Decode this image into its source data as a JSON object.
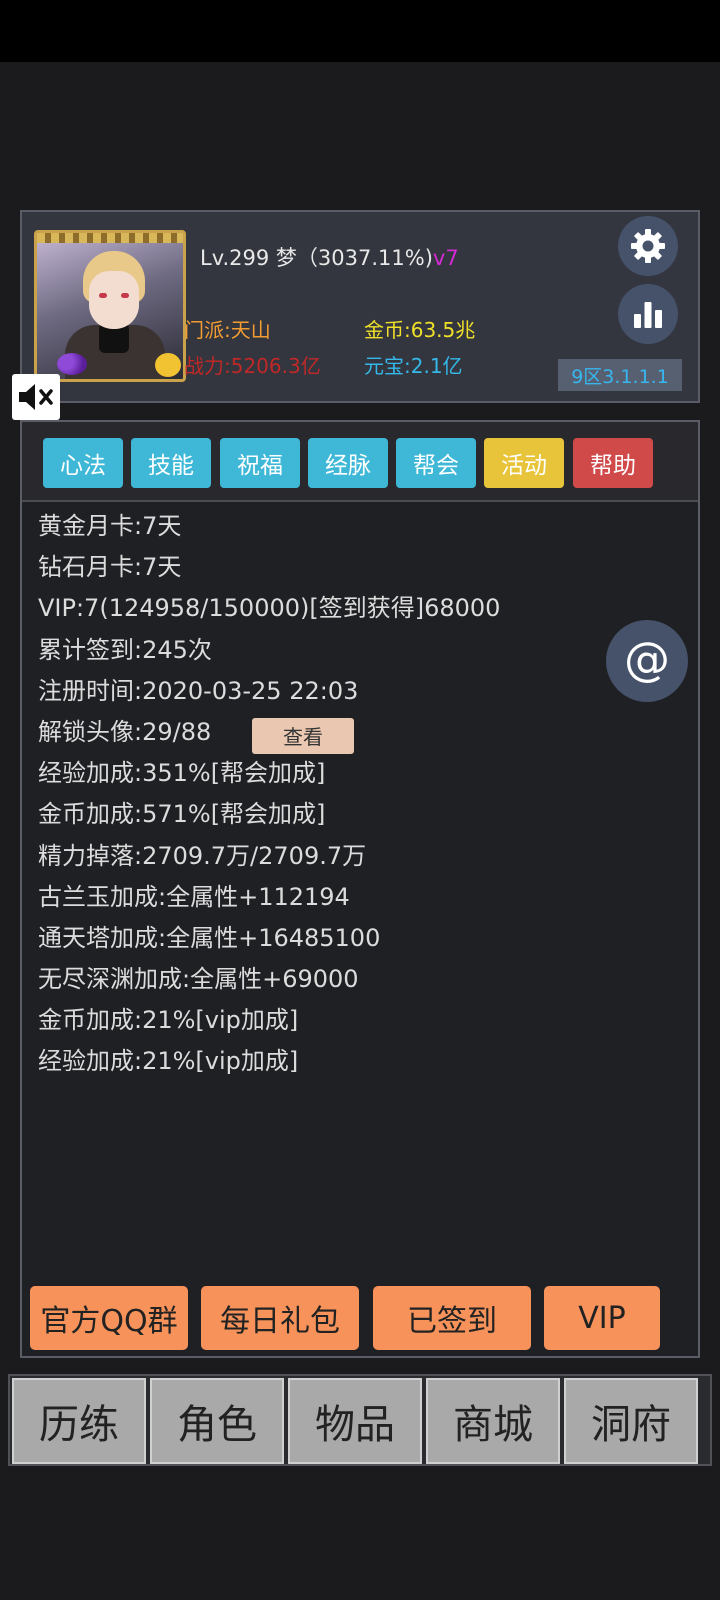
{
  "player": {
    "level_line": "Lv.299 梦（3037.11%)",
    "vip_tag": "v7",
    "sect": "门派:天山",
    "power": "战力:5206.3亿",
    "gold": "金币:63.5兆",
    "yuanbao": "元宝:2.1亿",
    "server": "9区3.1.1.1"
  },
  "tabs": [
    {
      "label": "心法",
      "color": "#3fb8d8"
    },
    {
      "label": "技能",
      "color": "#3fb8d8"
    },
    {
      "label": "祝福",
      "color": "#3fb8d8"
    },
    {
      "label": "经脉",
      "color": "#3fb8d8"
    },
    {
      "label": "帮会",
      "color": "#3fb8d8"
    },
    {
      "label": "活动",
      "color": "#e7c43a"
    },
    {
      "label": "帮助",
      "color": "#d04a4a"
    }
  ],
  "info": [
    "黄金月卡:7天",
    "钻石月卡:7天",
    "VIP:7(124958/150000)[签到获得]68000",
    "累计签到:245次",
    "注册时间:2020-03-25 22:03",
    "解锁头像:29/88",
    "经验加成:351%[帮会加成]",
    "金币加成:571%[帮会加成]",
    "精力掉落:2709.7万/2709.7万",
    "古兰玉加成:全属性+112194",
    "通天塔加成:全属性+16485100",
    "无尽深渊加成:全属性+69000",
    "金币加成:21%[vip加成]",
    "经验加成:21%[vip加成]"
  ],
  "view_button": "查看",
  "actions": [
    "官方QQ群",
    "每日礼包",
    "已签到",
    "VIP"
  ],
  "nav": [
    "历练",
    "角色",
    "物品",
    "商城",
    "洞府"
  ],
  "icons": {
    "settings": "gear-icon",
    "stats": "bar-chart-icon",
    "mute": "speaker-muted-icon",
    "at": "at-sign-icon"
  }
}
